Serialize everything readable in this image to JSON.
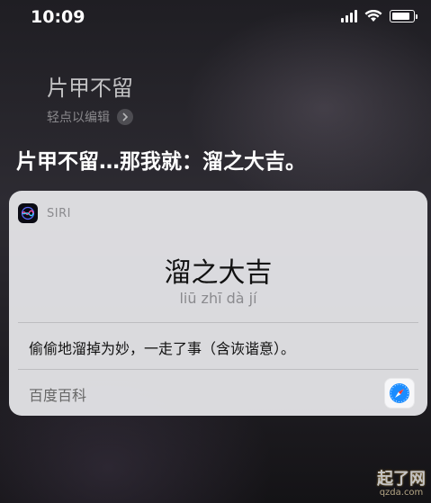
{
  "status_bar": {
    "time": "10:09",
    "icons": [
      "signal-icon",
      "wifi-icon",
      "battery-icon"
    ]
  },
  "siri": {
    "query": "片甲不留",
    "edit_hint": "轻点以编辑",
    "response": "片甲不留…那我就：溜之大吉。"
  },
  "card": {
    "header_label": "SIRI",
    "term": "溜之大吉",
    "pinyin": "liū zhī dà jí",
    "definition": "偷偷地溜掉为妙，一走了事（含诙谐意）。",
    "source": "百度百科",
    "source_icon": "safari-icon"
  },
  "watermark": {
    "text": "起了网",
    "url": "qzda.com"
  },
  "colors": {
    "card_background": "#e8e8ec",
    "secondary_text": "#8a8a8e",
    "safari_blue": "#1a8cff"
  }
}
